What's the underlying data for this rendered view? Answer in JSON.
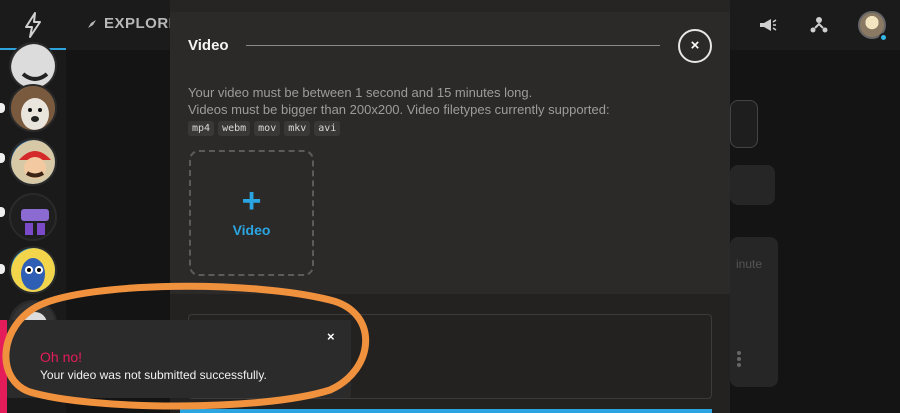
{
  "nav": {
    "explore_label": "EXPLORE"
  },
  "modal": {
    "title": "Video",
    "close_symbol": "×",
    "desc_line1": "Your video must be between 1 second and 15 minutes long.",
    "desc_line2": "Videos must be bigger than 200x200. Video filetypes currently supported:",
    "filetypes": [
      "mp4",
      "webm",
      "mov",
      "mkv",
      "avi"
    ],
    "upload_plus": "+",
    "upload_label": "Video"
  },
  "background": {
    "partial_text": "inute"
  },
  "toast": {
    "title": "Oh no!",
    "message": "Your video was not submitted successfully.",
    "close_symbol": "×"
  },
  "colors": {
    "accent_blue": "#2aa5e2",
    "error_pink": "#e51c5a",
    "annotation_orange": "#f0913e"
  },
  "icons": [
    "bolt-icon",
    "compass-icon",
    "megaphone-icon",
    "people-icon",
    "close-icon",
    "plus-icon",
    "more-vertical-icon"
  ]
}
